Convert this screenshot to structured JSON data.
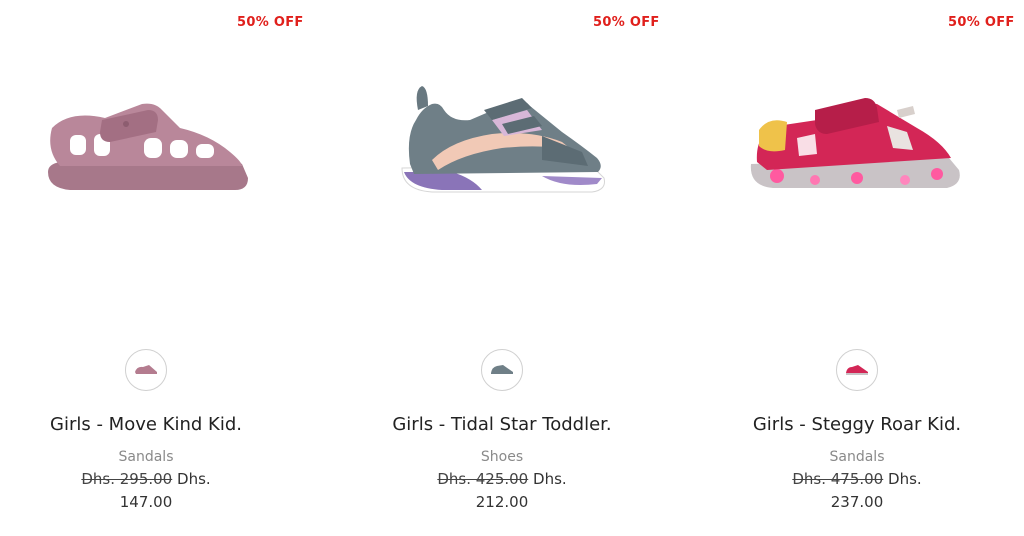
{
  "products": [
    {
      "badge": "50% OFF",
      "name": "Girls - Move Kind Kid.",
      "category": "Sandals",
      "old_price": "Dhs. 295.00",
      "currency": "Dhs.",
      "price": "147.00",
      "color": "#b47c8f",
      "icon": "sandal-image"
    },
    {
      "badge": "50% OFF",
      "name": "Girls - Tidal Star Toddler.",
      "category": "Shoes",
      "old_price": "Dhs. 425.00",
      "currency": "Dhs.",
      "price": "212.00",
      "color": "#6f7f87",
      "icon": "sneaker-image"
    },
    {
      "badge": "50% OFF",
      "name": "Girls - Steggy Roar Kid.",
      "category": "Sandals",
      "old_price": "Dhs. 475.00",
      "currency": "Dhs.",
      "price": "237.00",
      "color": "#d32656",
      "icon": "sandal-image"
    }
  ],
  "colors": {
    "badge": "#e0201c",
    "text": "#222222",
    "muted": "#8a8a8a"
  }
}
